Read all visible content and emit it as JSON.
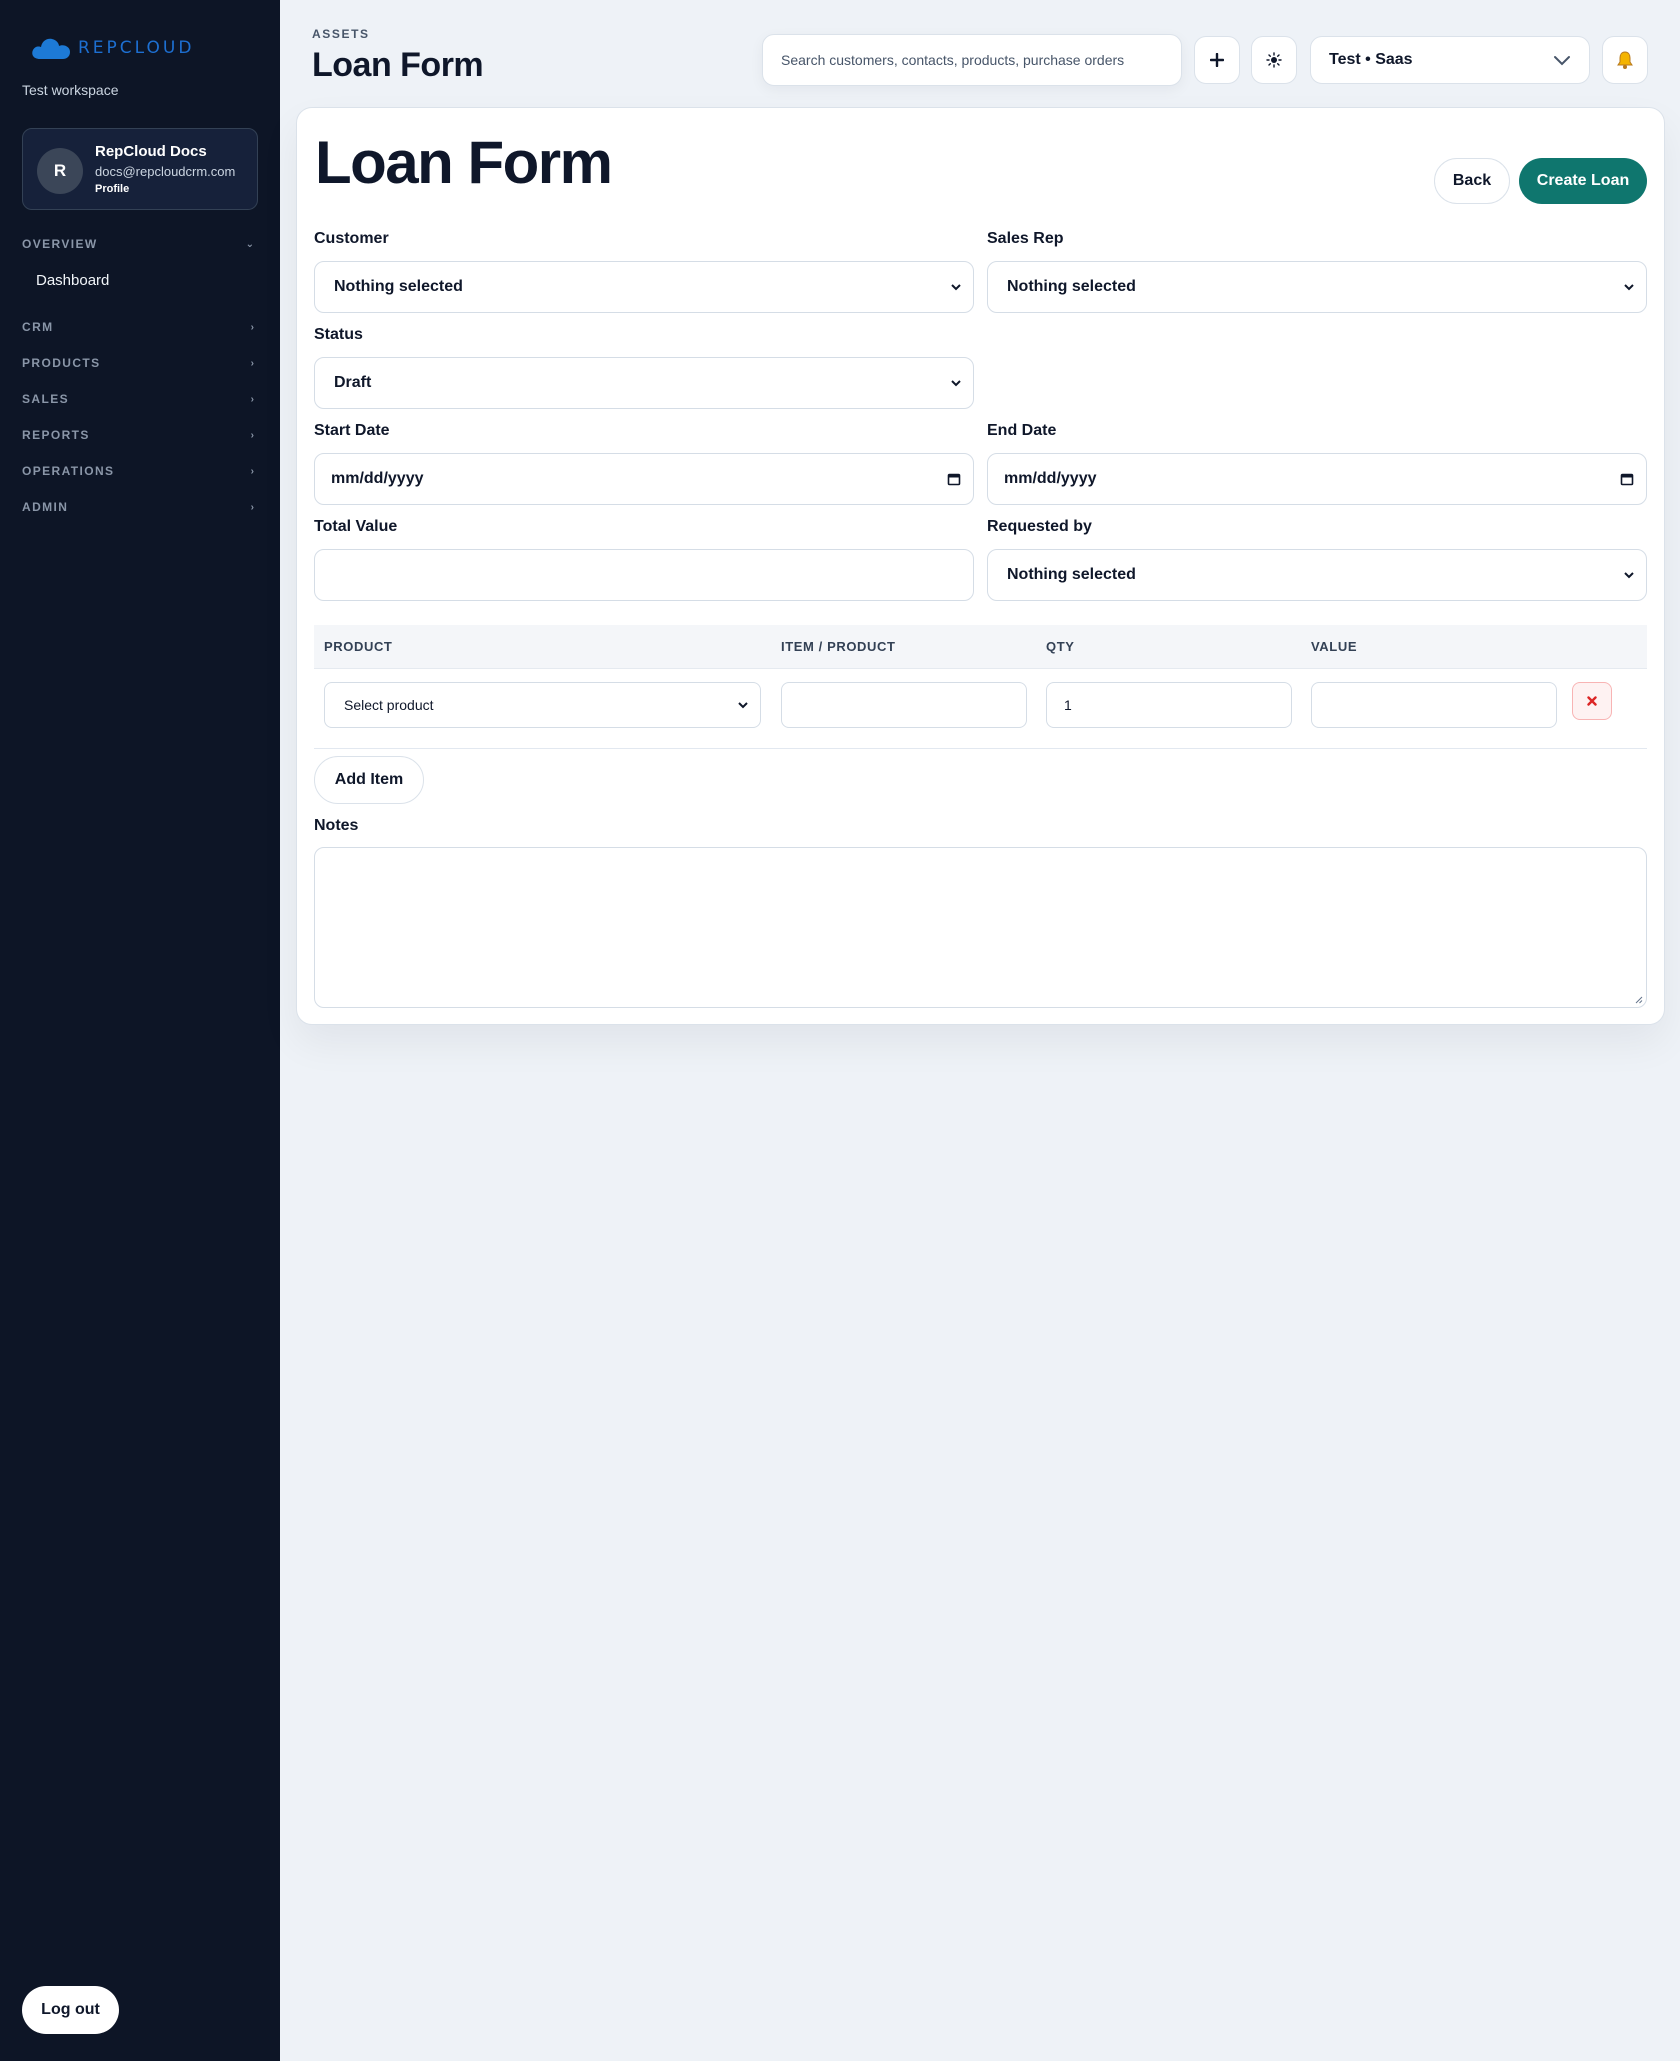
{
  "sidebar": {
    "logo_text": "REPCLOUD",
    "workspace": "Test workspace",
    "profile": {
      "initial": "R",
      "name": "RepCloud Docs",
      "email": "docs@repcloudcrm.com",
      "link": "Profile"
    },
    "sections": [
      {
        "label": "OVERVIEW",
        "chevron": "⌄"
      },
      {
        "label": "CRM",
        "chevron": "›"
      },
      {
        "label": "PRODUCTS",
        "chevron": "›"
      },
      {
        "label": "SALES",
        "chevron": "›"
      },
      {
        "label": "REPORTS",
        "chevron": "›"
      },
      {
        "label": "OPERATIONS",
        "chevron": "›"
      },
      {
        "label": "ADMIN",
        "chevron": "›"
      }
    ],
    "overview_items": [
      {
        "label": "Dashboard"
      }
    ],
    "logout_label": "Log out"
  },
  "header": {
    "breadcrumb": "ASSETS",
    "title": "Loan Form",
    "search_placeholder": "Search customers, contacts, products, purchase orders",
    "workspace_select": "Test • Saas",
    "icons": [
      "plus-icon",
      "sun-icon",
      "chevron-down-icon",
      "bell-icon"
    ]
  },
  "form": {
    "title": "Loan Form",
    "back_label": "Back",
    "create_label": "Create Loan",
    "customer": {
      "label": "Customer",
      "value": "Nothing selected"
    },
    "sales_rep": {
      "label": "Sales Rep",
      "value": "Nothing selected"
    },
    "status": {
      "label": "Status",
      "value": "Draft"
    },
    "start_date": {
      "label": "Start Date",
      "value": "mm/dd/yyyy"
    },
    "end_date": {
      "label": "End Date",
      "value": "mm/dd/yyyy"
    },
    "total_value": {
      "label": "Total Value",
      "value": ""
    },
    "requested_by": {
      "label": "Requested by",
      "value": "Nothing selected"
    },
    "items_table": {
      "headers": [
        "PRODUCT",
        "ITEM / PRODUCT",
        "QTY",
        "VALUE"
      ],
      "rows": [
        {
          "product": "Select product",
          "item": "",
          "qty": "1",
          "value": ""
        }
      ]
    },
    "add_item_label": "Add Item",
    "notes": {
      "label": "Notes",
      "value": ""
    }
  },
  "colors": {
    "sidebar_bg": "#0d1526",
    "accent": "#0f766e",
    "logo_blue": "#1d6fd1",
    "page_bg": "#eef2f7",
    "danger": "#dc2626"
  }
}
